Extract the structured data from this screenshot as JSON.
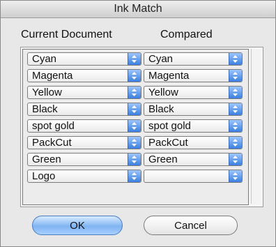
{
  "window": {
    "title": "Ink Match"
  },
  "columns": {
    "current": "Current Document",
    "compared": "Compared"
  },
  "rows": [
    {
      "current": "Cyan",
      "compared": "Cyan"
    },
    {
      "current": "Magenta",
      "compared": "Magenta"
    },
    {
      "current": "Yellow",
      "compared": "Yellow"
    },
    {
      "current": "Black",
      "compared": "Black"
    },
    {
      "current": "spot gold",
      "compared": "spot gold"
    },
    {
      "current": "PackCut",
      "compared": "PackCut"
    },
    {
      "current": "Green",
      "compared": "Green"
    },
    {
      "current": "Logo",
      "compared": ""
    }
  ],
  "buttons": {
    "ok": "OK",
    "cancel": "Cancel"
  },
  "icons": {
    "popup": "up-down-arrows-icon"
  },
  "colors": {
    "accent": "#3b7fe0",
    "default_button": "#7fb4f2"
  }
}
